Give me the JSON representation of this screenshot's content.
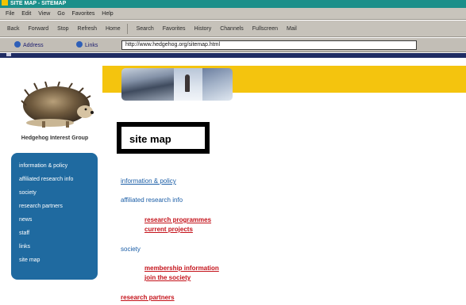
{
  "browser": {
    "title": "SITE MAP - SITEMAP",
    "menu": [
      "File",
      "Edit",
      "View",
      "Go",
      "Favorites",
      "Help"
    ],
    "toolbar": [
      "Back",
      "Forward",
      "Stop",
      "Refresh",
      "Home",
      "Search",
      "Favorites",
      "History",
      "Channels",
      "Fullscreen",
      "Mail"
    ],
    "links_label": "Address",
    "channel_label": "Links",
    "address": "http://www.hedgehog.org/sitemap.html"
  },
  "page": {
    "caption": "Hedgehog Interest Group",
    "heading": "site map",
    "nav": [
      "information & policy",
      "affiliated research info",
      "society",
      "research partners",
      "news",
      "staff",
      "links",
      "site map"
    ],
    "sections": [
      {
        "label": "information & policy",
        "underline": true
      },
      {
        "label": "affiliated research info",
        "underline": false
      },
      {
        "label": "society",
        "underline": false
      },
      {
        "label": "research partners",
        "underline": false
      }
    ],
    "subsections": [
      {
        "label": "research programmes",
        "sub": "current projects"
      },
      {
        "label": "membership information",
        "sub": "join the society"
      }
    ]
  },
  "colors": {
    "titlebar": "#1b8f8a",
    "band": "#f4c40e",
    "nav_bg": "#1f6aa0",
    "link": "#1a5da6",
    "sublink": "#c4121a"
  }
}
